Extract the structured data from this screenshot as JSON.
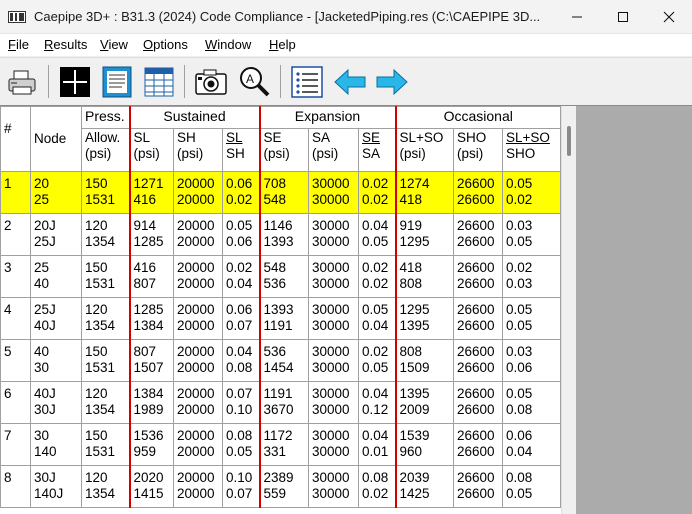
{
  "window": {
    "title": "Caepipe 3D+ : B31.3 (2024) Code Compliance -  [JacketedPiping.res (C:\\CAEPIPE 3D..."
  },
  "menu": [
    "File",
    "Results",
    "View",
    "Options",
    "Window",
    "Help"
  ],
  "menu_underline": [
    "F",
    "R",
    "V",
    "O",
    "W",
    "H"
  ],
  "toolbar": [
    "print-icon",
    "cross-section-icon",
    "document-icon",
    "table-icon",
    "camera-icon",
    "zoom-icon",
    "list-icon",
    "back-arrow-icon",
    "forward-arrow-icon"
  ],
  "table": {
    "group_headers": {
      "press": "Press.",
      "sustained": "Sustained",
      "expansion": "Expansion",
      "occasional": "Occasional"
    },
    "col_headers": {
      "idx": "#",
      "node": "Node",
      "allow": [
        "Allow.",
        "(psi)"
      ],
      "sl": [
        "SL",
        "(psi)"
      ],
      "sh": [
        "SH",
        "(psi)"
      ],
      "slsh": [
        "SL",
        "SH"
      ],
      "se": [
        "SE",
        "(psi)"
      ],
      "sa": [
        "SA",
        "(psi)"
      ],
      "sesa": [
        "SE",
        "SA"
      ],
      "slso": [
        "SL+SO",
        "(psi)"
      ],
      "sho": [
        "SHO",
        "(psi)"
      ],
      "slsosho": [
        "SL+SO",
        "SHO"
      ]
    },
    "rows": [
      {
        "idx": "1",
        "node": [
          "20",
          "25"
        ],
        "allow": [
          "150",
          "1531"
        ],
        "sl": [
          "1271",
          "416"
        ],
        "sh": [
          "20000",
          "20000"
        ],
        "slsh": [
          "0.06",
          "0.02"
        ],
        "se": [
          "708",
          "548"
        ],
        "sa": [
          "30000",
          "30000"
        ],
        "sesa": [
          "0.02",
          "0.02"
        ],
        "slso": [
          "1274",
          "418"
        ],
        "sho": [
          "26600",
          "26600"
        ],
        "ratio": [
          "0.05",
          "0.02"
        ]
      },
      {
        "idx": "2",
        "node": [
          "20J",
          "25J"
        ],
        "allow": [
          "120",
          "1354"
        ],
        "sl": [
          "914",
          "1285"
        ],
        "sh": [
          "20000",
          "20000"
        ],
        "slsh": [
          "0.05",
          "0.06"
        ],
        "se": [
          "1146",
          "1393"
        ],
        "sa": [
          "30000",
          "30000"
        ],
        "sesa": [
          "0.04",
          "0.05"
        ],
        "slso": [
          "919",
          "1295"
        ],
        "sho": [
          "26600",
          "26600"
        ],
        "ratio": [
          "0.03",
          "0.05"
        ]
      },
      {
        "idx": "3",
        "node": [
          "25",
          "40"
        ],
        "allow": [
          "150",
          "1531"
        ],
        "sl": [
          "416",
          "807"
        ],
        "sh": [
          "20000",
          "20000"
        ],
        "slsh": [
          "0.02",
          "0.04"
        ],
        "se": [
          "548",
          "536"
        ],
        "sa": [
          "30000",
          "30000"
        ],
        "sesa": [
          "0.02",
          "0.02"
        ],
        "slso": [
          "418",
          "808"
        ],
        "sho": [
          "26600",
          "26600"
        ],
        "ratio": [
          "0.02",
          "0.03"
        ]
      },
      {
        "idx": "4",
        "node": [
          "25J",
          "40J"
        ],
        "allow": [
          "120",
          "1354"
        ],
        "sl": [
          "1285",
          "1384"
        ],
        "sh": [
          "20000",
          "20000"
        ],
        "slsh": [
          "0.06",
          "0.07"
        ],
        "se": [
          "1393",
          "1191"
        ],
        "sa": [
          "30000",
          "30000"
        ],
        "sesa": [
          "0.05",
          "0.04"
        ],
        "slso": [
          "1295",
          "1395"
        ],
        "sho": [
          "26600",
          "26600"
        ],
        "ratio": [
          "0.05",
          "0.05"
        ]
      },
      {
        "idx": "5",
        "node": [
          "40",
          "30"
        ],
        "allow": [
          "150",
          "1531"
        ],
        "sl": [
          "807",
          "1507"
        ],
        "sh": [
          "20000",
          "20000"
        ],
        "slsh": [
          "0.04",
          "0.08"
        ],
        "se": [
          "536",
          "1454"
        ],
        "sa": [
          "30000",
          "30000"
        ],
        "sesa": [
          "0.02",
          "0.05"
        ],
        "slso": [
          "808",
          "1509"
        ],
        "sho": [
          "26600",
          "26600"
        ],
        "ratio": [
          "0.03",
          "0.06"
        ]
      },
      {
        "idx": "6",
        "node": [
          "40J",
          "30J"
        ],
        "allow": [
          "120",
          "1354"
        ],
        "sl": [
          "1384",
          "1989"
        ],
        "sh": [
          "20000",
          "20000"
        ],
        "slsh": [
          "0.07",
          "0.10"
        ],
        "se": [
          "1191",
          "3670"
        ],
        "sa": [
          "30000",
          "30000"
        ],
        "sesa": [
          "0.04",
          "0.12"
        ],
        "slso": [
          "1395",
          "2009"
        ],
        "sho": [
          "26600",
          "26600"
        ],
        "ratio": [
          "0.05",
          "0.08"
        ]
      },
      {
        "idx": "7",
        "node": [
          "30",
          "140"
        ],
        "allow": [
          "150",
          "1531"
        ],
        "sl": [
          "1536",
          "959"
        ],
        "sh": [
          "20000",
          "20000"
        ],
        "slsh": [
          "0.08",
          "0.05"
        ],
        "se": [
          "1172",
          "331"
        ],
        "sa": [
          "30000",
          "30000"
        ],
        "sesa": [
          "0.04",
          "0.01"
        ],
        "slso": [
          "1539",
          "960"
        ],
        "sho": [
          "26600",
          "26600"
        ],
        "ratio": [
          "0.06",
          "0.04"
        ]
      },
      {
        "idx": "8",
        "node": [
          "30J",
          "140J"
        ],
        "allow": [
          "120",
          "1354"
        ],
        "sl": [
          "2020",
          "1415"
        ],
        "sh": [
          "20000",
          "20000"
        ],
        "slsh": [
          "0.10",
          "0.07"
        ],
        "se": [
          "2389",
          "559"
        ],
        "sa": [
          "30000",
          "30000"
        ],
        "sesa": [
          "0.08",
          "0.02"
        ],
        "slso": [
          "2039",
          "1425"
        ],
        "sho": [
          "26600",
          "26600"
        ],
        "ratio": [
          "0.08",
          "0.05"
        ]
      }
    ],
    "selected_row": "1",
    "highlight_color": "#ffff00",
    "divider_color": "#d40000"
  }
}
